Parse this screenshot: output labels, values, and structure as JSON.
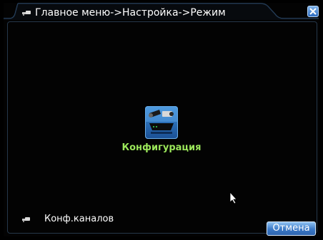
{
  "window": {
    "title": "Главное меню->Настройка->Режим"
  },
  "main": {
    "config_item": {
      "label": "Конфигурация",
      "icon": "camera-config-icon"
    },
    "channel_item": {
      "label": "Конф.каналов",
      "icon": "channel-config-icon"
    }
  },
  "footer": {
    "cancel_label": "Отмена"
  },
  "colors": {
    "accent_label": "#9be75a",
    "button_blue": "#3b79c7",
    "frame_border": "#25374a"
  }
}
